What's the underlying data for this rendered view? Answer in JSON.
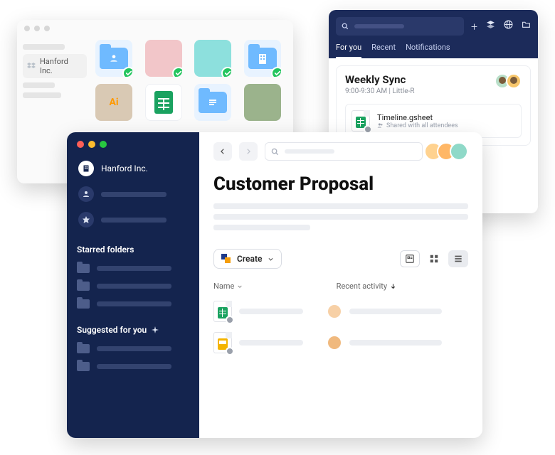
{
  "win1": {
    "brand": "Hanford Inc."
  },
  "win2": {
    "tabs": {
      "for_you": "For you",
      "recent": "Recent",
      "notifications": "Notifications"
    },
    "toolbar_icons": {
      "plus": "+",
      "stack": "stack",
      "globe": "globe",
      "folder": "folder"
    },
    "card": {
      "title": "Weekly Sync",
      "time": "9:00-9:30 AM",
      "room": "Little-R",
      "file_name": "Timeline.gsheet",
      "shared_text": "Shared with all attendees"
    }
  },
  "win3": {
    "brand": "Hanford Inc.",
    "sections": {
      "starred": "Starred folders",
      "suggested": "Suggested for you"
    },
    "page_title": "Customer Proposal",
    "toolbar": {
      "create": "Create"
    },
    "columns": {
      "name": "Name",
      "recent": "Recent activity"
    }
  }
}
